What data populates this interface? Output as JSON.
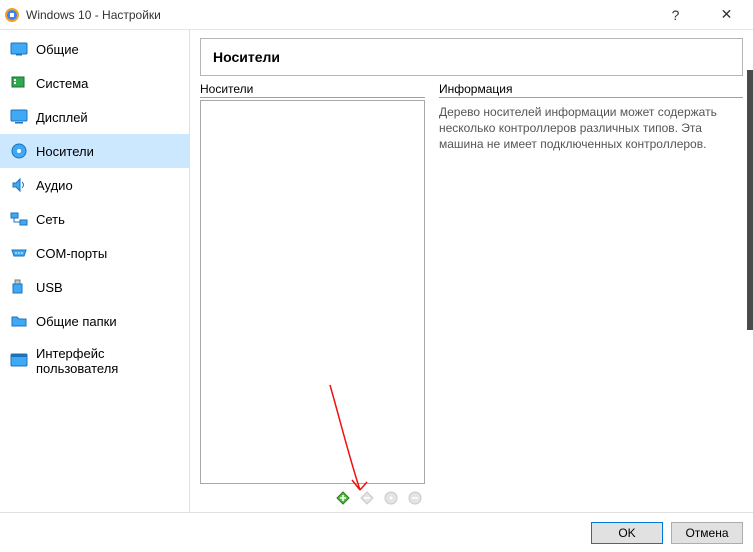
{
  "window": {
    "title": "Windows 10 - Настройки"
  },
  "sidebar": {
    "items": [
      {
        "label": "Общие"
      },
      {
        "label": "Система"
      },
      {
        "label": "Дисплей"
      },
      {
        "label": "Носители"
      },
      {
        "label": "Аудио"
      },
      {
        "label": "Сеть"
      },
      {
        "label": "COM-порты"
      },
      {
        "label": "USB"
      },
      {
        "label": "Общие папки"
      },
      {
        "label": "Интерфейс пользователя"
      }
    ]
  },
  "page": {
    "header": "Носители",
    "tree_label": "Носители",
    "info_label": "Информация",
    "info_text": "Дерево носителей информации может содержать несколько контроллеров различных типов. Эта машина не имеет подключенных контроллеров."
  },
  "toolbar": {
    "add_controller": "Добавить контроллер",
    "remove_controller": "Удалить контроллер",
    "add_attachment": "Добавить привод",
    "remove_attachment": "Удалить привод"
  },
  "footer": {
    "ok": "OK",
    "cancel": "Отмена"
  }
}
